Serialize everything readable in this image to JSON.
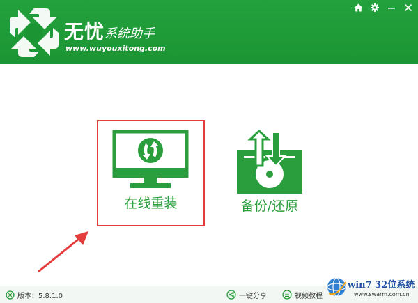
{
  "header": {
    "title": "无忧",
    "subtitle": "系统助手",
    "url": "www.wuyouxitong.com",
    "controls": {
      "home_icon": "home-icon",
      "settings_icon": "gear-icon",
      "minimize_icon": "minimize-icon",
      "close_icon": "close-icon"
    }
  },
  "main": {
    "tiles": [
      {
        "label": "在线重装",
        "icon": "monitor-refresh-icon",
        "selected": true
      },
      {
        "label": "备份/还原",
        "icon": "backup-restore-icon",
        "selected": false
      }
    ]
  },
  "footer": {
    "version": "版本：5.8.1.0",
    "share": "一键分享",
    "video": "视频教程"
  },
  "watermark": {
    "text": "win7 32位系统",
    "url": "www.swarm.com.cn"
  },
  "colors": {
    "brand_green": "#1b9533",
    "icon_green": "#2a9e3c",
    "highlight_red": "#e53d3d",
    "watermark_blue": "#1d4fa0"
  }
}
